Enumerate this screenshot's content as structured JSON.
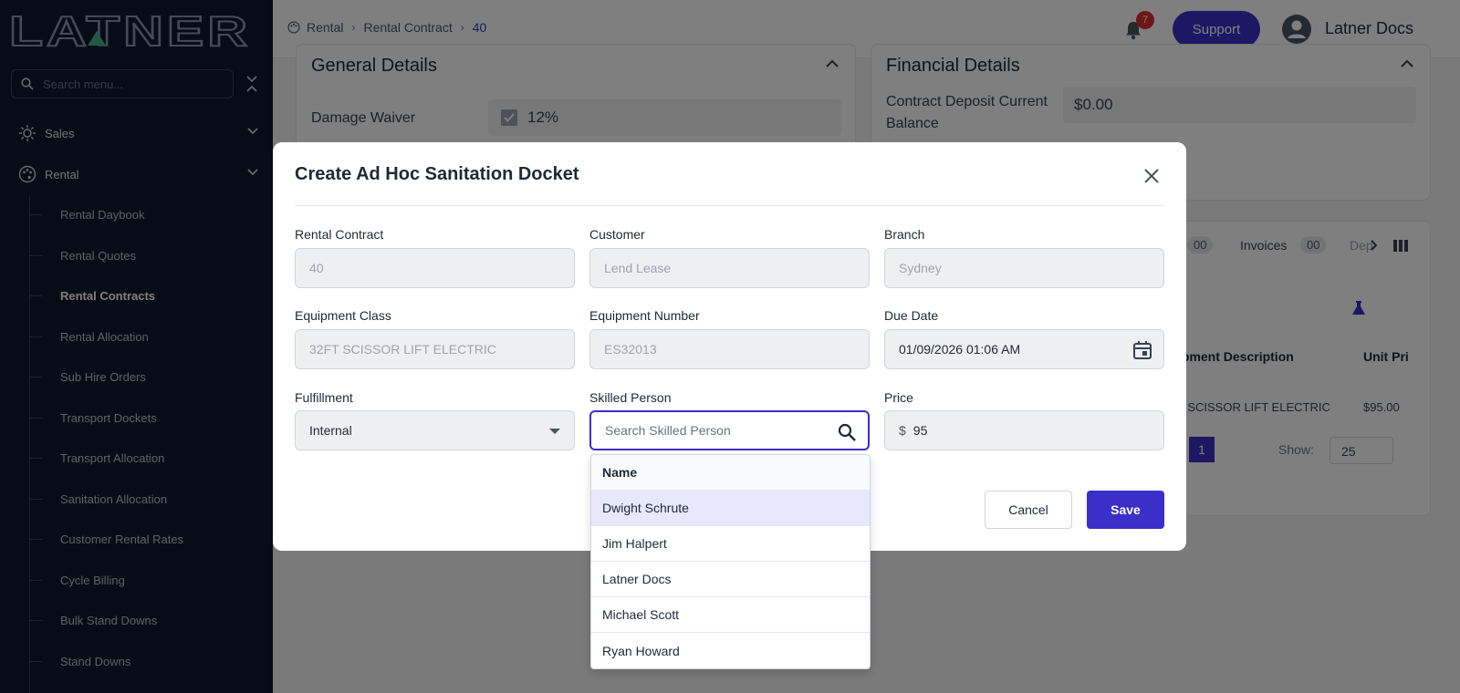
{
  "brand": {
    "logo_text": "LATNER"
  },
  "sidebar": {
    "search_placeholder": "Search menu...",
    "groups": [
      {
        "label": "Sales",
        "icon": "sun-icon"
      },
      {
        "label": "Rental",
        "icon": "palette-icon"
      }
    ],
    "items": [
      {
        "label": "Rental Daybook",
        "active": false
      },
      {
        "label": "Rental Quotes",
        "active": false
      },
      {
        "label": "Rental Contracts",
        "active": true
      },
      {
        "label": "Rental Allocation",
        "active": false
      },
      {
        "label": "Sub Hire Orders",
        "active": false
      },
      {
        "label": "Transport Dockets",
        "active": false
      },
      {
        "label": "Transport Allocation",
        "active": false
      },
      {
        "label": "Sanitation Allocation",
        "active": false
      },
      {
        "label": "Customer Rental Rates",
        "active": false
      },
      {
        "label": "Cycle Billing",
        "active": false
      },
      {
        "label": "Bulk Stand Downs",
        "active": false
      },
      {
        "label": "Stand Downs",
        "active": false
      }
    ]
  },
  "header": {
    "breadcrumb": [
      "Rental",
      "Rental Contract",
      "40"
    ],
    "notifications_count": "7",
    "support_label": "Support",
    "user_name": "Latner Docs"
  },
  "background": {
    "general_details": {
      "title": "General Details",
      "field_label": "Damage Waiver",
      "field_value": "12%"
    },
    "financial_details": {
      "title": "Financial Details",
      "field_label_line1": "Contract Deposit Current",
      "field_label_line2": "Balance",
      "field_value": "$0.00"
    },
    "tabs": {
      "count1": "00",
      "invoices_label": "Invoices",
      "invoices_count": "00",
      "next_label": "Dep"
    },
    "table": {
      "col1": "ipment Description",
      "col2": "Unit Pri",
      "cell1": "T SCISSOR LIFT ELECTRIC",
      "cell2": "$95.00"
    },
    "pagination": {
      "page": "1",
      "show_label": "Show:",
      "show_value": "25"
    }
  },
  "modal": {
    "title": "Create Ad Hoc Sanitation Docket",
    "fields": {
      "rental_contract": {
        "label": "Rental Contract",
        "value": "40"
      },
      "customer": {
        "label": "Customer",
        "value": "Lend Lease"
      },
      "branch": {
        "label": "Branch",
        "value": "Sydney"
      },
      "equipment_class": {
        "label": "Equipment Class",
        "value": "32FT SCISSOR LIFT ELECTRIC"
      },
      "equipment_number": {
        "label": "Equipment Number",
        "value": "ES32013"
      },
      "due_date": {
        "label": "Due Date",
        "value": "01/09/2026 01:06 AM"
      },
      "fulfillment": {
        "label": "Fulfillment",
        "value": "Internal"
      },
      "skilled_person": {
        "label": "Skilled Person",
        "placeholder": "Search Skilled Person"
      },
      "price": {
        "label": "Price",
        "currency": "$",
        "value": "95"
      }
    },
    "cancel_label": "Cancel",
    "save_label": "Save"
  },
  "dropdown": {
    "header": "Name",
    "options": [
      "Dwight Schrute",
      "Jim Halpert",
      "Latner Docs",
      "Michael Scott",
      "Ryan Howard"
    ],
    "highlighted_index": 0
  },
  "colors": {
    "accent": "#3b2fc9",
    "sidebar_bg": "#0f1b2d",
    "logo_green": "#3fb58a",
    "badge": "#d93030"
  }
}
